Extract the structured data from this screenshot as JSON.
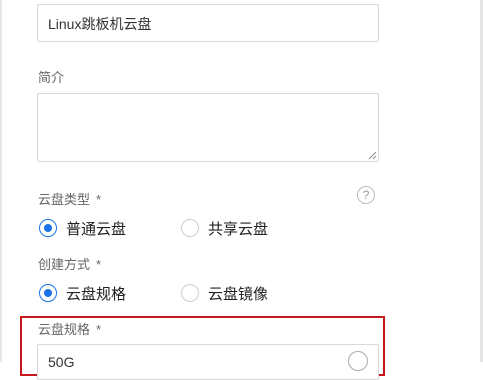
{
  "form": {
    "name_value": "Linux跳板机云盘",
    "description_label": "简介",
    "description_value": "",
    "disk_type": {
      "label": "云盘类型",
      "required_mark": "*",
      "help_icon": "question-circle-icon",
      "options": [
        "普通云盘",
        "共享云盘"
      ],
      "selected": "普通云盘"
    },
    "create_method": {
      "label": "创建方式",
      "required_mark": "*",
      "options": [
        "云盘规格",
        "云盘镜像"
      ],
      "selected": "云盘规格"
    },
    "disk_spec": {
      "label": "云盘规格",
      "required_mark": "*",
      "value": "50G"
    }
  },
  "colors": {
    "accent": "#1a73e8",
    "highlight_border": "#c8161d"
  }
}
